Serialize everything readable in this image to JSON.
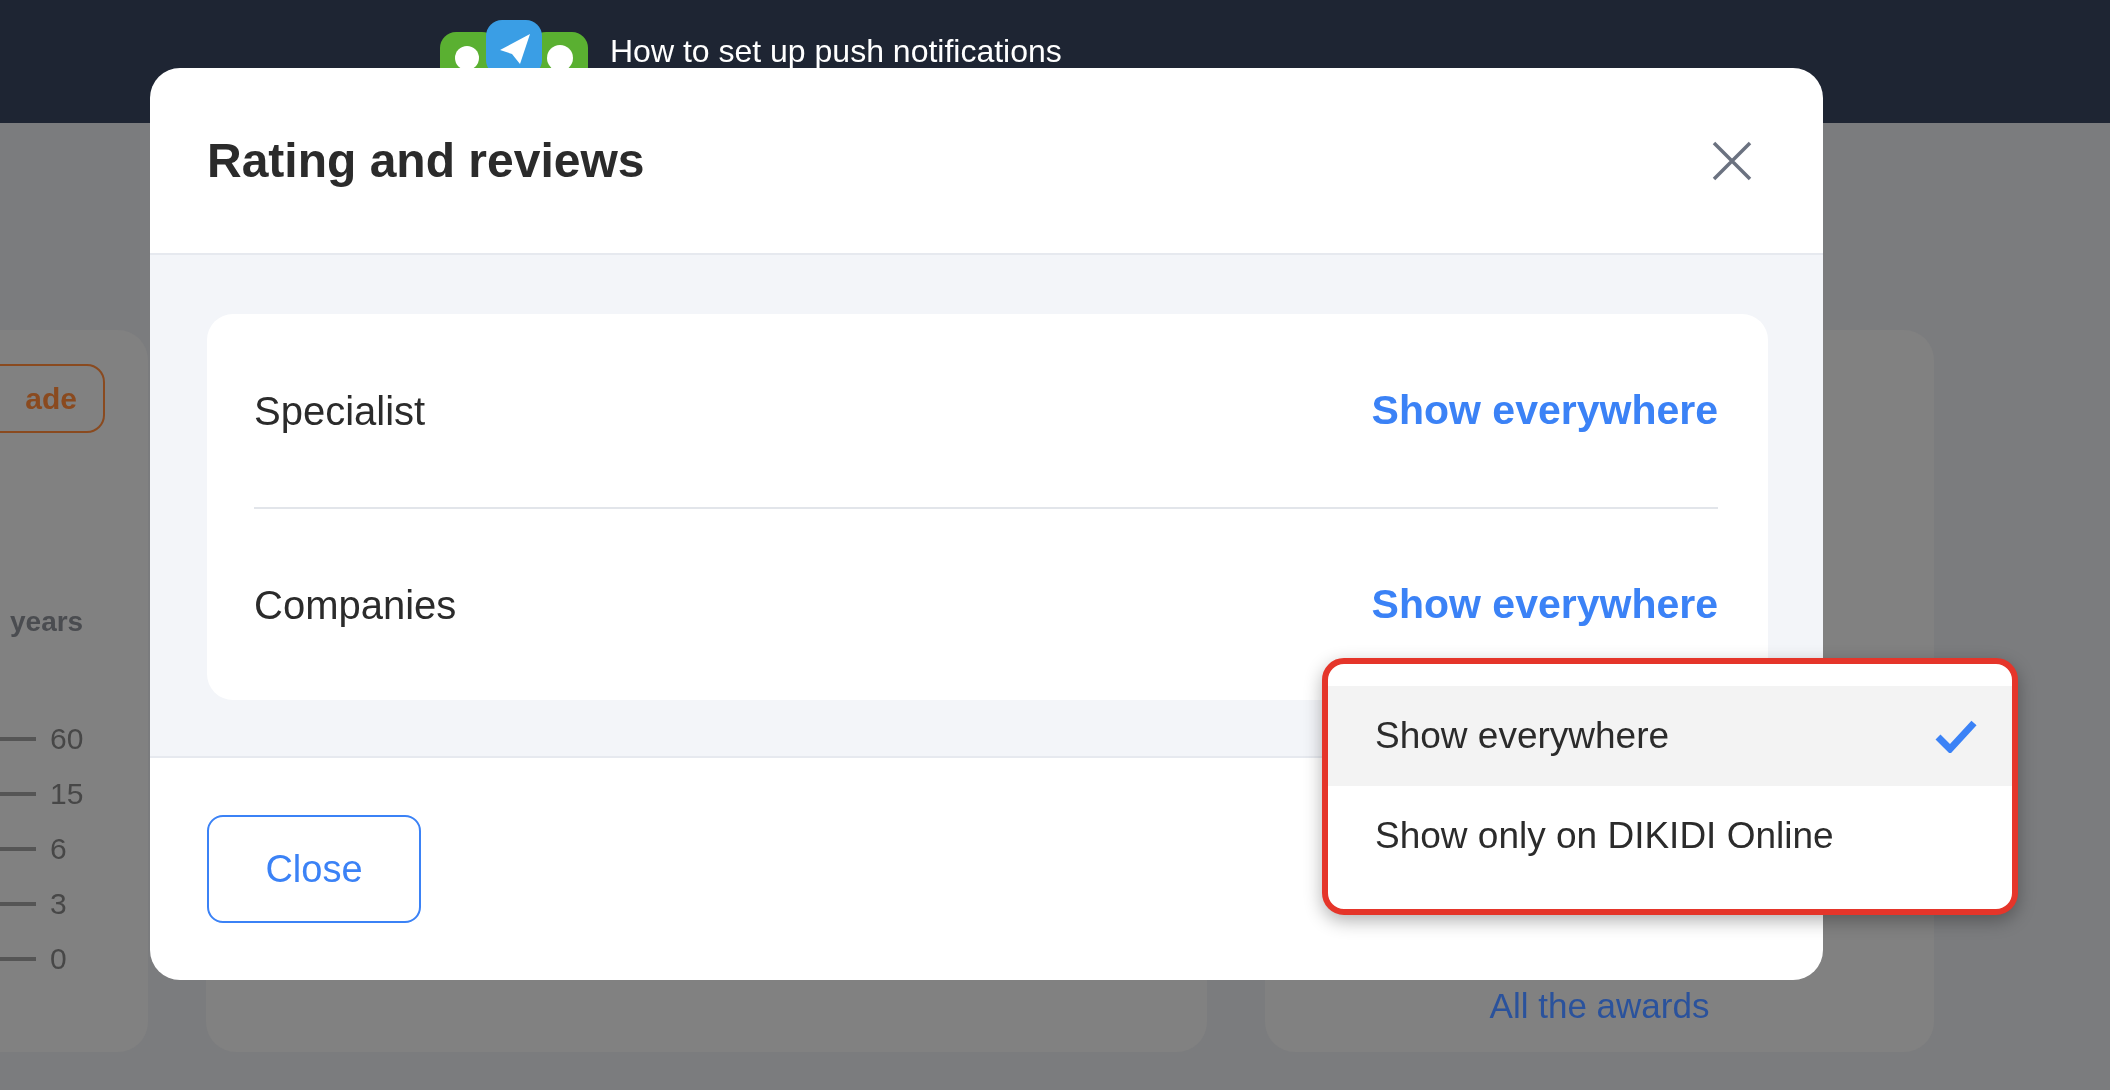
{
  "top_bar": {
    "title": "How to set up push notifications"
  },
  "background": {
    "button_label": "ade",
    "axis_title": "years",
    "axis_ticks": [
      "60",
      "15",
      "6",
      "3",
      "0"
    ],
    "link": "All the awards"
  },
  "modal": {
    "title": "Rating and reviews",
    "settings": [
      {
        "label": "Specialist",
        "value": "Show everywhere"
      },
      {
        "label": "Companies",
        "value": "Show everywhere"
      }
    ],
    "close_button": "Close"
  },
  "dropdown": {
    "options": [
      {
        "label": "Show everywhere",
        "selected": true
      },
      {
        "label": "Show only on DIKIDI Online",
        "selected": false
      }
    ]
  }
}
